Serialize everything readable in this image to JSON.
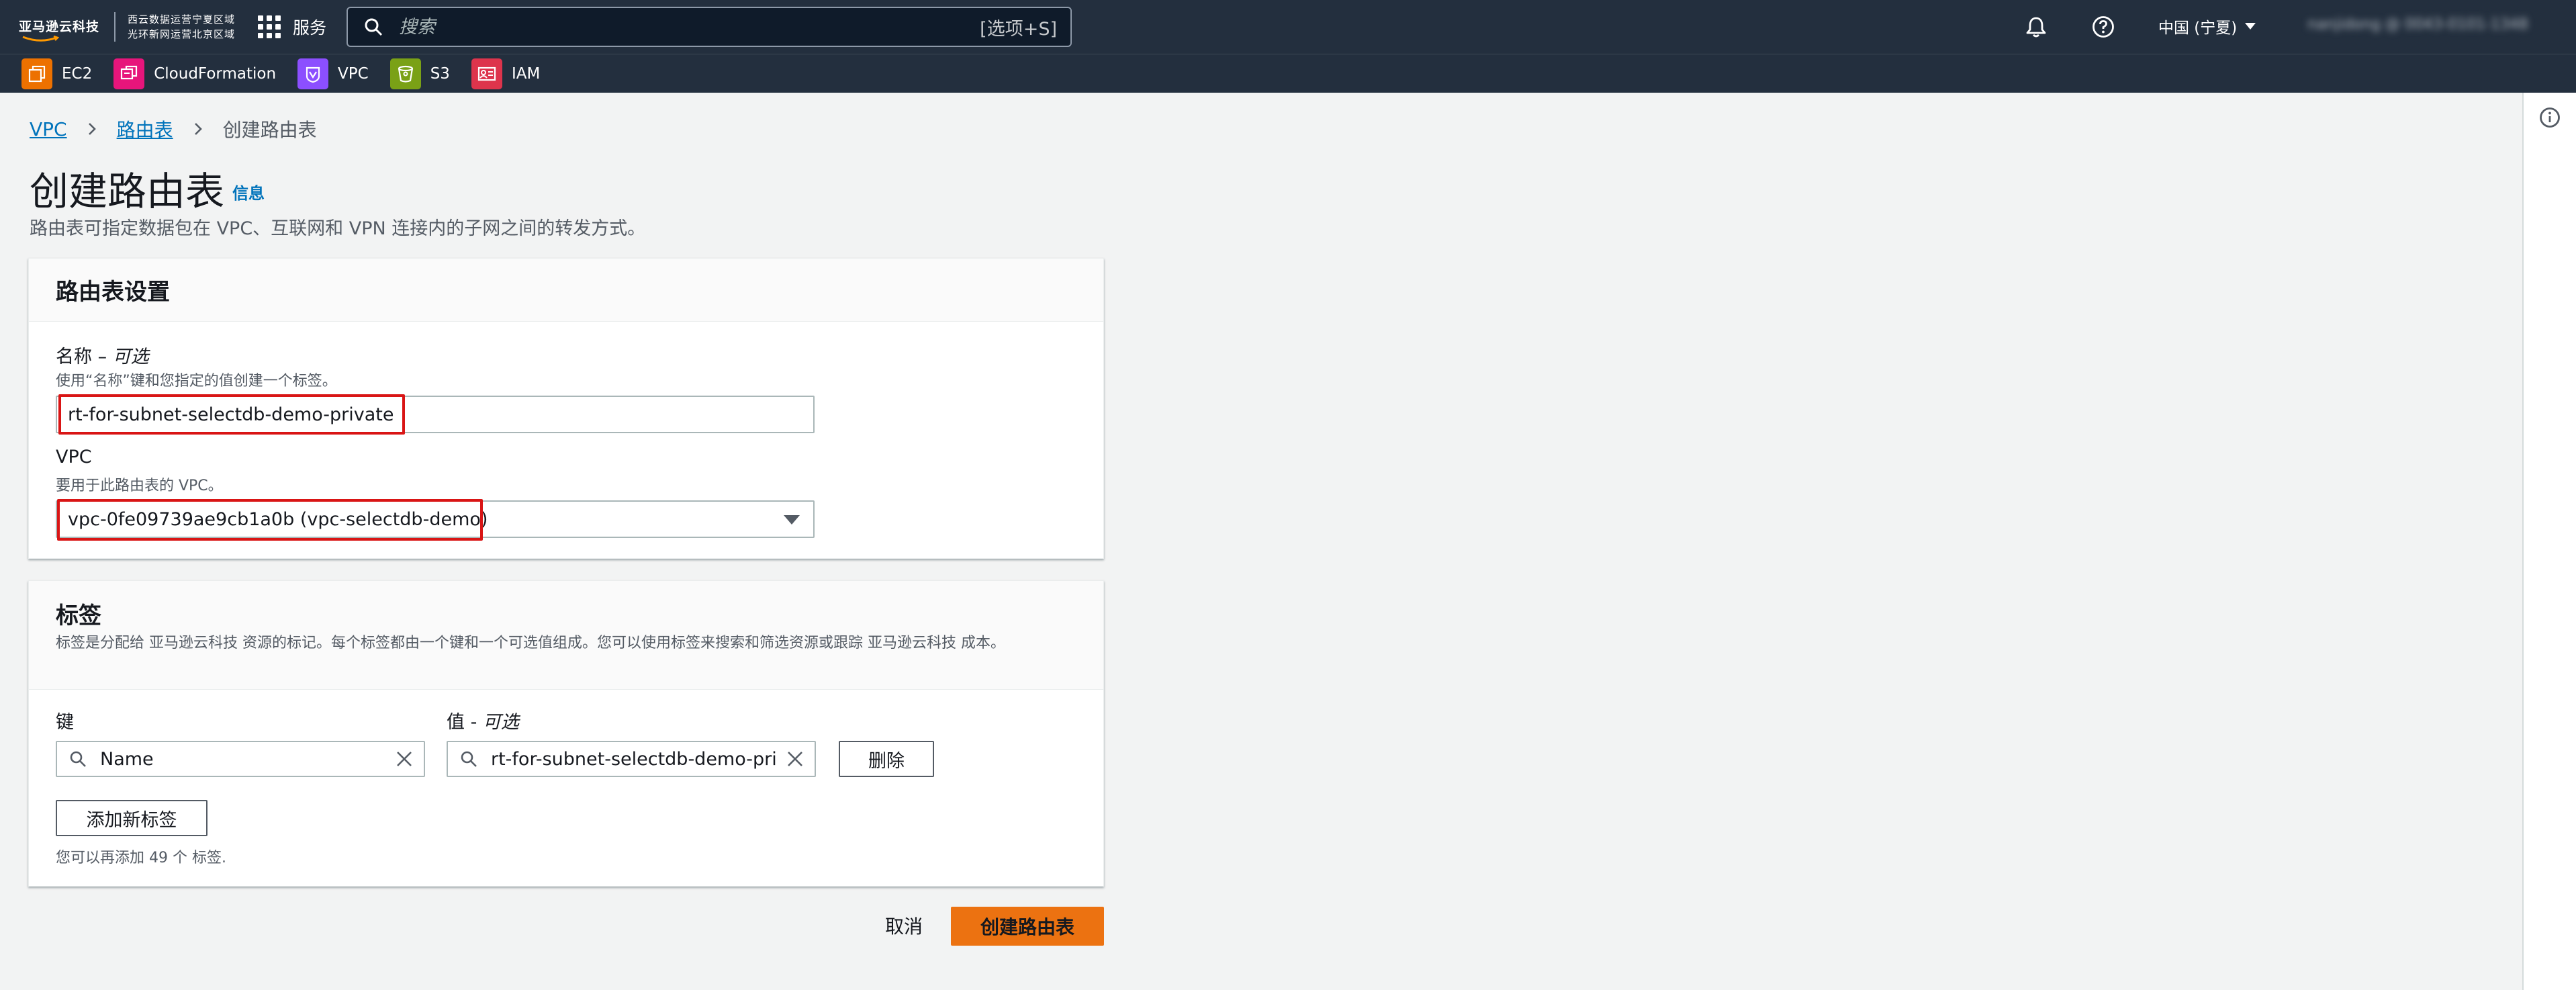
{
  "topnav": {
    "logo_main": "亚马逊云科技",
    "logo_sub_line1": "西云数据运营宁夏区域",
    "logo_sub_line2": "光环新网运营北京区域",
    "services_label": "服务",
    "search_placeholder": "搜索",
    "search_shortcut": "[选项+S]",
    "region_label": "中国 (宁夏)",
    "account_label": "nanjidong @ 0043-0101-1348"
  },
  "favorites": [
    {
      "label": "EC2",
      "color": "#ed7100"
    },
    {
      "label": "CloudFormation",
      "color": "#e7157b"
    },
    {
      "label": "VPC",
      "color": "#8c4fff"
    },
    {
      "label": "S3",
      "color": "#7aa116"
    },
    {
      "label": "IAM",
      "color": "#dd344c"
    }
  ],
  "breadcrumb": {
    "item1": "VPC",
    "item2": "路由表",
    "current": "创建路由表"
  },
  "page": {
    "title": "创建路由表",
    "info": "信息",
    "description": "路由表可指定数据包在 VPC、互联网和 VPN 连接内的子网之间的转发方式。"
  },
  "settings_panel": {
    "title": "路由表设置",
    "name_label": "名称 – ",
    "name_optional": "可选",
    "name_desc": "使用“名称”键和您指定的值创建一个标签。",
    "name_value": "rt-for-subnet-selectdb-demo-private",
    "vpc_label": "VPC",
    "vpc_desc": "要用于此路由表的 VPC。",
    "vpc_value": "vpc-0fe09739ae9cb1a0b (vpc-selectdb-demo)"
  },
  "tags_panel": {
    "title": "标签",
    "description": "标签是分配给 亚马逊云科技 资源的标记。每个标签都由一个键和一个可选值组成。您可以使用标签来搜索和筛选资源或跟踪 亚马逊云科技 成本。",
    "key_label": "键",
    "value_label": "值 - ",
    "value_optional": "可选",
    "key_value": "Name",
    "value_value": "rt-for-subnet-selectdb-demo-private",
    "remove_label": "删除",
    "add_label": "添加新标签",
    "limit_text": "您可以再添加 49 个 标签."
  },
  "actions": {
    "cancel": "取消",
    "create": "创建路由表"
  },
  "colors": {
    "nav_bg": "#232f3e",
    "link": "#0073bb",
    "primary": "#ec7211",
    "highlight": "#d91515"
  }
}
